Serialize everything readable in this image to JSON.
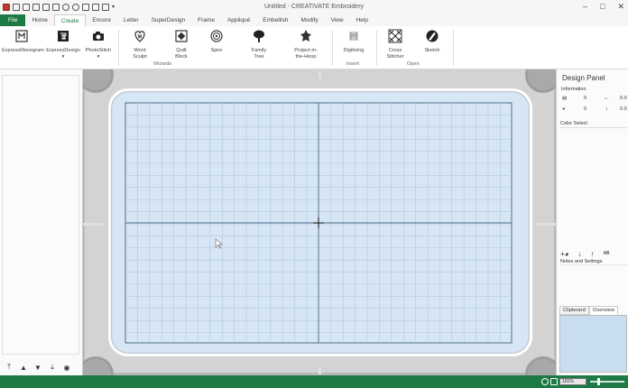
{
  "window": {
    "title": "Untitled - CREATIVATE Embroidery",
    "controls": [
      "–",
      "□",
      "✕"
    ]
  },
  "quick_access": [
    "app-icon",
    "new-icon",
    "open-icon",
    "save-icon",
    "save-as-icon",
    "print-icon",
    "undo-icon",
    "redo-icon",
    "cut-icon",
    "paste-icon",
    "play-icon",
    "customize-icon"
  ],
  "menu": {
    "tabs": [
      "File",
      "Home",
      "Create",
      "Encore",
      "Letter",
      "SuperDesign",
      "Frame",
      "Appliqué",
      "Embellish",
      "Modify",
      "View",
      "Help"
    ],
    "active": "Create"
  },
  "ribbon": {
    "buttons": [
      {
        "label": "ExpressMonogram",
        "icon": "monogram-icon"
      },
      {
        "label": "ExpressDesign",
        "icon": "express-design-icon",
        "has_dropdown": true
      },
      {
        "label": "PhotoStitch",
        "icon": "camera-icon",
        "has_dropdown": true
      },
      {
        "label": "Word\nSculpt",
        "icon": "word-sculpt-icon"
      },
      {
        "label": "Quilt\nBlock",
        "icon": "quilt-block-icon"
      },
      {
        "label": "Spiro",
        "icon": "spiro-icon"
      },
      {
        "label": "Family\nTree",
        "icon": "tree-icon"
      },
      {
        "label": "Project-in-\nthe-Hoop",
        "icon": "project-hoop-icon"
      },
      {
        "label": "Digitizing",
        "icon": "digitizing-icon"
      },
      {
        "label": "Cross\nStitcher",
        "icon": "cross-stitch-icon"
      },
      {
        "label": "Sketch",
        "icon": "sketch-icon"
      }
    ],
    "groups": [
      "Wizards",
      "Insert",
      "Open"
    ]
  },
  "design_panel": {
    "title": "Design Panel",
    "information_label": "Information",
    "info_rows": [
      {
        "left_icon": "stitch-count-icon",
        "left_value": "0",
        "right_icon": "width-icon",
        "right_value": "0.0"
      },
      {
        "left_icon": "color-count-icon",
        "left_value": "0",
        "right_icon": "height-icon",
        "right_value": "0.0"
      }
    ],
    "color_select_label": "Color Select",
    "notes_label": "Notes and Settings",
    "bottom_tabs": [
      "Clipboard",
      "Overview"
    ],
    "active_bottom_tab": "Overview"
  },
  "left_nav_buttons": [
    "move-to-top-icon",
    "move-up-icon",
    "move-down-icon",
    "move-to-bottom-icon",
    "view-options-icon"
  ],
  "status": {
    "zoom": "101%"
  },
  "colors": {
    "accent": "#1d7a45",
    "sewing_field": "#d7e6f4",
    "grid_line": "#a8c2dc",
    "axis_line": "#2f4f6f"
  }
}
